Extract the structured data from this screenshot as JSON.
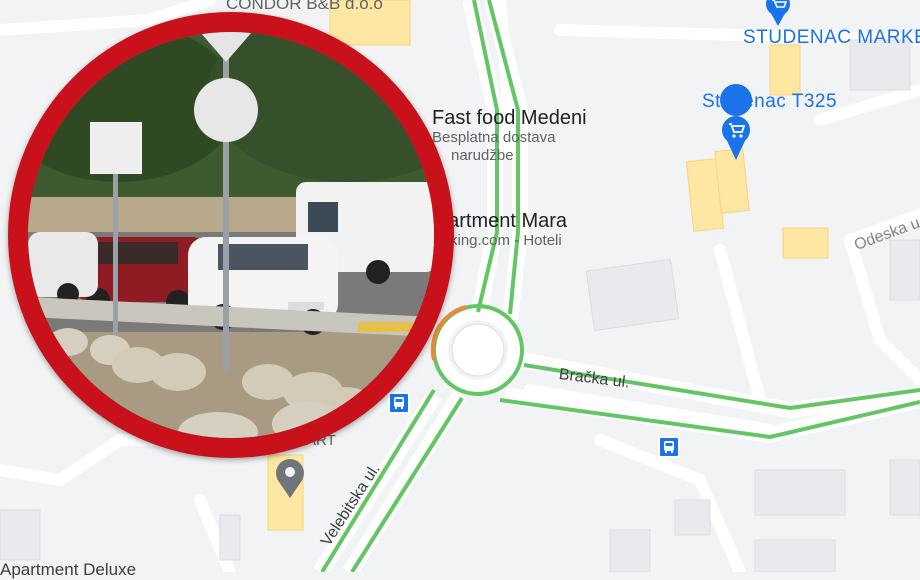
{
  "map": {
    "places": {
      "condor": {
        "title": "CONDOR B&B d.o.o"
      },
      "medeni": {
        "title": "Fast food Medeni",
        "line1": "Besplatna dostava",
        "line2": "narudžbe"
      },
      "mara": {
        "title": "partment Mara",
        "subtitle": "king.com - Hoteli"
      },
      "studenac_market": {
        "title": "STUDENAC MARKE"
      },
      "studenac_t325": {
        "title": "Studenac T325"
      },
      "deluxe": {
        "title": "Apartment Deluxe"
      },
      "partial_art": {
        "title": "ART"
      }
    },
    "streets": {
      "bracka": "Bračka ul.",
      "velebitska": "Velebitska ul.",
      "odeska": "Odeska u"
    },
    "icons": {
      "shop_pin": "shopping-cart-pin-icon",
      "location_pin": "location-pin-icon",
      "bus": "bus-stop-icon"
    },
    "colors": {
      "background": "#f1f3f4",
      "road": "#ffffff",
      "traffic_fast": "#63c563",
      "traffic_slow": "#e88a3a",
      "building": "#e8eaed",
      "poi_building": "#fde7a3",
      "shop_pin": "#1a73e8",
      "place_pin": "#70757a",
      "lens_ring": "#c8111a"
    }
  },
  "inset": {
    "description_visible": false,
    "colors": {
      "sky_trees": "#3f5a2e",
      "wall": "#b9a98c",
      "asphalt": "#7a7b78",
      "van": "#f2f2f2",
      "car_red": "#8e1c22",
      "car_white": "#f4f4f4"
    }
  }
}
